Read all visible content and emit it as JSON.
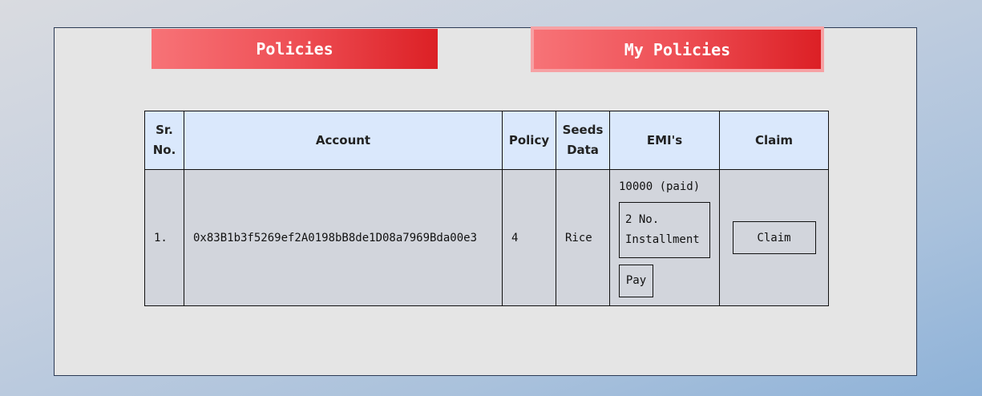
{
  "tabs": {
    "policies_label": "Policies",
    "my_policies_label": "My Policies"
  },
  "table": {
    "headers": {
      "sr_no": "Sr. No.",
      "account": "Account",
      "policy": "Policy",
      "seeds_data": "Seeds Data",
      "emis": "EMI's",
      "claim": "Claim"
    },
    "rows": [
      {
        "sr_no": "1.",
        "account": "0x83B1b3f5269ef2A0198bB8de1D08a7969Bda00e3",
        "policy": "4",
        "seeds_data": "Rice",
        "emi_amount": "10000 (paid)",
        "installment": "2 No. Installment",
        "pay_label": "Pay",
        "claim_label": "Claim"
      }
    ]
  },
  "colors": {
    "tab_gradient_start": "#f77377",
    "tab_gradient_end": "#dc2025",
    "header_bg": "#dae8fc",
    "row_bg": "#d2d5dc",
    "panel_bg": "#e5e5e5"
  }
}
